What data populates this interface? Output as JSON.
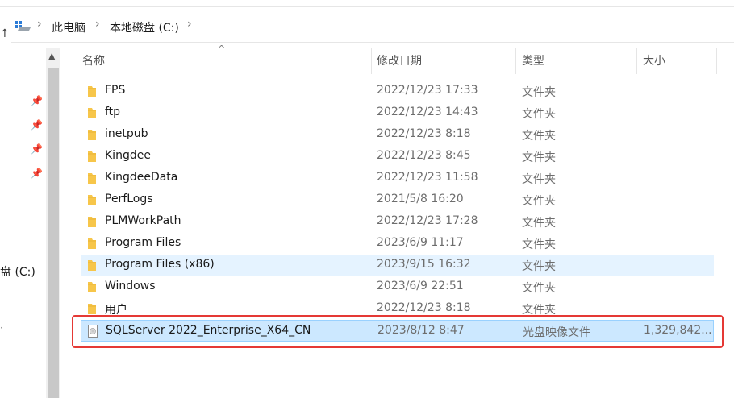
{
  "address": {
    "crumbs": [
      "此电脑",
      "本地磁盘 (C:)"
    ]
  },
  "nav": {
    "label": "盘 (C:)"
  },
  "columns": {
    "name": "名称",
    "date": "修改日期",
    "type": "类型",
    "size": "大小"
  },
  "files": [
    {
      "name": "FPS",
      "date": "2022/12/23 17:33",
      "type": "文件夹",
      "size": "",
      "icon": "folder-icon"
    },
    {
      "name": "ftp",
      "date": "2022/12/23 14:43",
      "type": "文件夹",
      "size": "",
      "icon": "folder-icon"
    },
    {
      "name": "inetpub",
      "date": "2022/12/23 8:18",
      "type": "文件夹",
      "size": "",
      "icon": "folder-icon"
    },
    {
      "name": "Kingdee",
      "date": "2022/12/23 8:45",
      "type": "文件夹",
      "size": "",
      "icon": "folder-icon"
    },
    {
      "name": "KingdeeData",
      "date": "2022/12/23 11:58",
      "type": "文件夹",
      "size": "",
      "icon": "folder-icon"
    },
    {
      "name": "PerfLogs",
      "date": "2021/5/8 16:20",
      "type": "文件夹",
      "size": "",
      "icon": "folder-icon"
    },
    {
      "name": "PLMWorkPath",
      "date": "2022/12/23 17:28",
      "type": "文件夹",
      "size": "",
      "icon": "folder-icon"
    },
    {
      "name": "Program Files",
      "date": "2023/6/9 11:17",
      "type": "文件夹",
      "size": "",
      "icon": "folder-icon"
    },
    {
      "name": "Program Files (x86)",
      "date": "2023/9/15 16:32",
      "type": "文件夹",
      "size": "",
      "icon": "folder-icon"
    },
    {
      "name": "Windows",
      "date": "2023/6/9 22:51",
      "type": "文件夹",
      "size": "",
      "icon": "folder-icon"
    },
    {
      "name": "用户",
      "date": "2022/12/23 8:18",
      "type": "文件夹",
      "size": "",
      "icon": "folder-icon"
    },
    {
      "name": "SQLServer 2022_Enterprise_X64_CN",
      "date": "2023/8/12 8:47",
      "type": "光盘映像文件",
      "size": "1,329,842...",
      "icon": "disc-image-icon"
    }
  ],
  "colors": {
    "hover_row": "#e5f3ff",
    "selected_row": "#cce8ff",
    "highlight_box": "#e53935",
    "folder": "#f7c64a"
  }
}
